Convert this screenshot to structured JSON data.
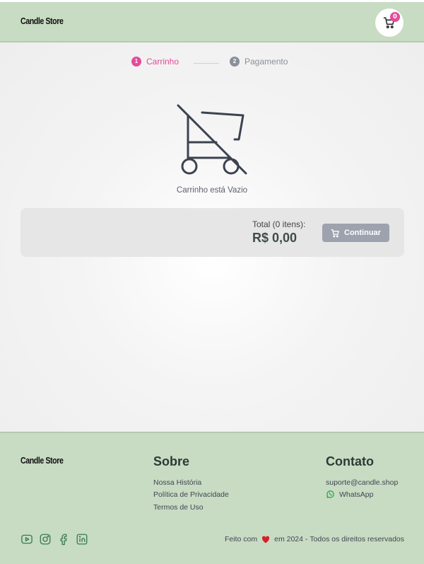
{
  "header": {
    "logo": "Candle Store",
    "cart_count": "0"
  },
  "steps": [
    {
      "num": "1",
      "label": "Carrinho",
      "active": true
    },
    {
      "num": "2",
      "label": "Pagamento",
      "active": false
    }
  ],
  "cart": {
    "empty_message": "Carrinho está Vazio",
    "total_label": "Total (0 itens):",
    "total_value": "R$ 0,00",
    "continue_label": "Continuar"
  },
  "footer": {
    "logo": "Candle Store",
    "sobre": {
      "title": "Sobre",
      "links": [
        "Nossa História",
        "Política de Privacidade",
        "Termos de Uso"
      ]
    },
    "contato": {
      "title": "Contato",
      "email": "suporte@candle.shop",
      "whatsapp": "WhatsApp"
    },
    "socials": [
      "youtube-icon",
      "instagram-icon",
      "facebook-icon",
      "linkedin-icon"
    ],
    "copyright": {
      "made_with": "Feito com",
      "year_text": "em 2024",
      "rights": "Todos os direitos reservados"
    }
  },
  "colors": {
    "accent": "#e54a9a",
    "brand_green": "#c7dcc2",
    "button_gray": "#9da2ae",
    "whatsapp": "#25a244",
    "heart": "#d81f2a"
  }
}
